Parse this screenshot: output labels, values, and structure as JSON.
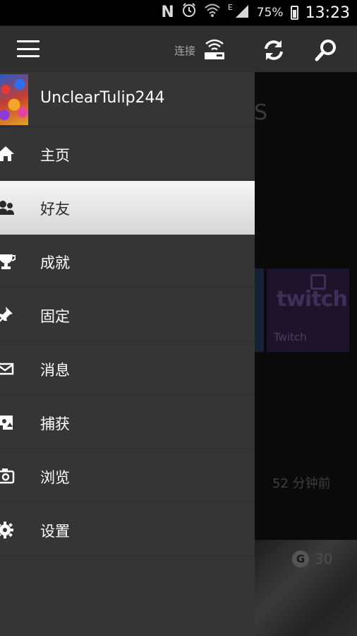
{
  "status_bar": {
    "icons": [
      "nfc-icon",
      "alarm-icon",
      "wifi-icon",
      "cell-signal-icon",
      "battery-icon"
    ],
    "network_type": "E",
    "battery": "75%",
    "time": "13:23"
  },
  "app_bar": {
    "connect_label": "连接",
    "icons": [
      "hamburger-menu-icon",
      "console-connect-icon",
      "refresh-icon",
      "search-icon"
    ]
  },
  "drawer": {
    "username": "UnclearTulip244",
    "selected_index": 1,
    "items": [
      {
        "label": "主页",
        "icon": "home-icon"
      },
      {
        "label": "好友",
        "icon": "friends-icon"
      },
      {
        "label": "成就",
        "icon": "trophy-icon"
      },
      {
        "label": "固定",
        "icon": "pin-icon"
      },
      {
        "label": "消息",
        "icon": "envelope-icon"
      },
      {
        "label": "捕获",
        "icon": "capture-icon"
      },
      {
        "label": "浏览",
        "icon": "browse-icon"
      },
      {
        "label": "设置",
        "icon": "gear-icon"
      }
    ]
  },
  "background": {
    "heading_fragment": "S",
    "twitch_tile_label": "Twitch",
    "twitch_logo_text": "twitch",
    "timestamp": "52 分钟前",
    "score_badge": "G",
    "score_value": "30"
  },
  "colors": {
    "app_bar": "#2f2f2f",
    "drawer": "#353535",
    "selected_item": "#e8e8e8",
    "twitch_tile": "#1d142b"
  }
}
